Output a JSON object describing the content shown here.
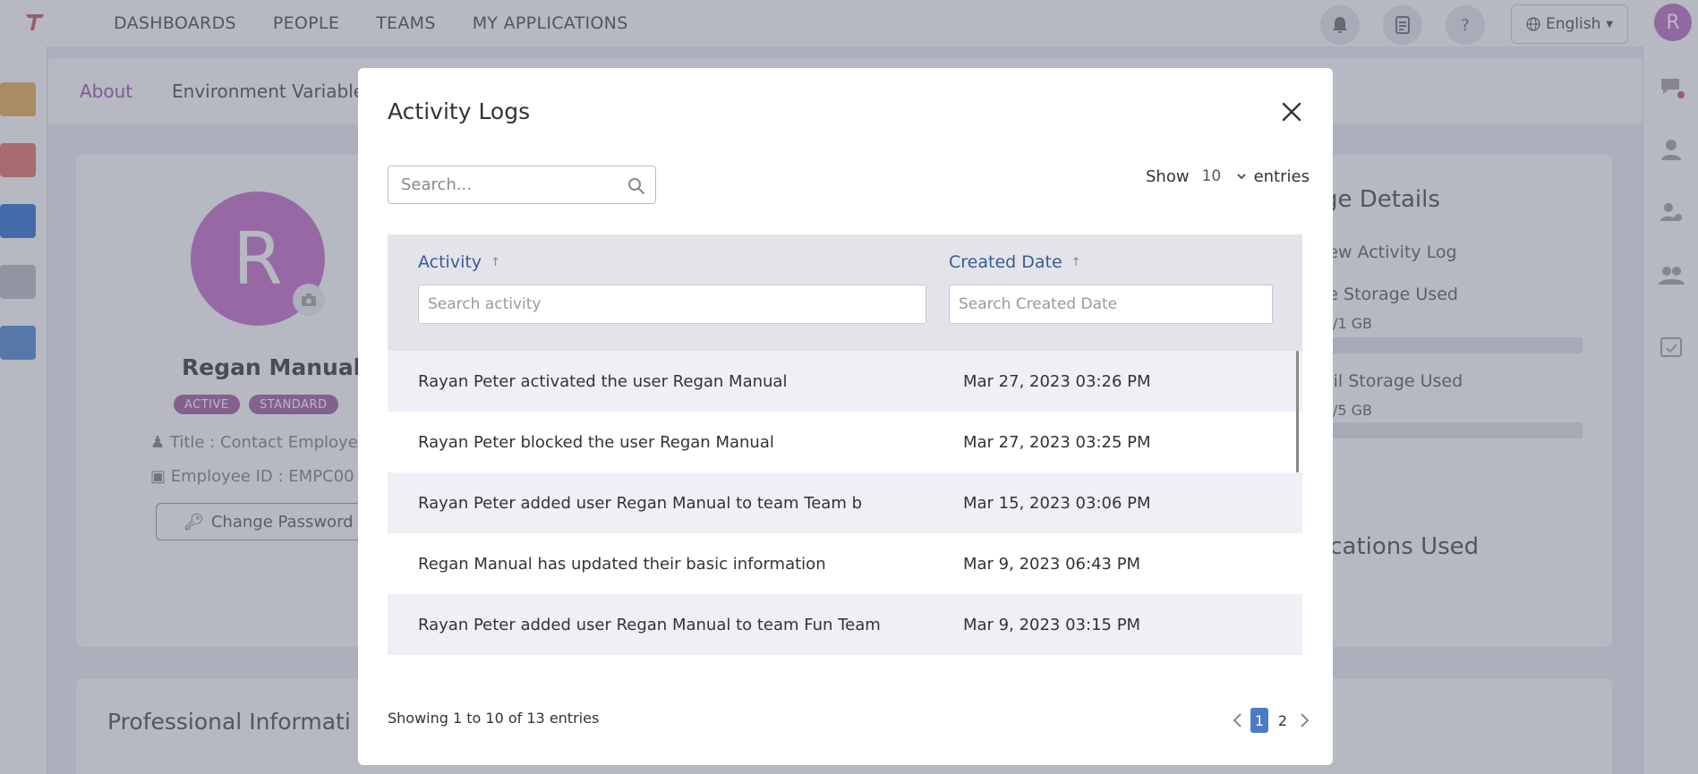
{
  "nav": {
    "items": [
      "DASHBOARDS",
      "PEOPLE",
      "TEAMS",
      "MY APPLICATIONS"
    ],
    "language": "English",
    "user_initial": "R"
  },
  "subtabs": [
    "About",
    "Environment Variable"
  ],
  "profile": {
    "initial": "R",
    "name": "Regan Manual",
    "badges": [
      "ACTIVE",
      "STANDARD"
    ],
    "title": "Title : Contact Employe",
    "employee_id": "Employee ID : EMPC00",
    "change_password": "Change Password"
  },
  "right_panel": {
    "heading": "ge Details",
    "view_log": "iew Activity Log",
    "file_storage": "le Storage Used",
    "file_storage_value": "B/1 GB",
    "mail_storage": "ail Storage Used",
    "mail_storage_value": "B/5 GB",
    "apps_heading": "ications Used"
  },
  "professional": {
    "heading": "Professional Informati"
  },
  "modal": {
    "title": "Activity Logs",
    "search_placeholder": "Search...",
    "show_label": "Show",
    "entries_count": "10",
    "entries_label": "entries",
    "columns": [
      {
        "label": "Activity",
        "filter_placeholder": "Search activity"
      },
      {
        "label": "Created Date",
        "filter_placeholder": "Search Created Date"
      }
    ],
    "rows": [
      {
        "activity": "Rayan Peter activated the user Regan Manual",
        "date": "Mar 27, 2023 03:26 PM"
      },
      {
        "activity": "Rayan Peter blocked the user Regan Manual",
        "date": "Mar 27, 2023 03:25 PM"
      },
      {
        "activity": "Rayan Peter added user Regan Manual to team Team b",
        "date": "Mar 15, 2023 03:06 PM"
      },
      {
        "activity": "Regan Manual has updated their basic information",
        "date": "Mar 9, 2023 06:43 PM"
      },
      {
        "activity": "Rayan Peter added user Regan Manual to team Fun Team",
        "date": "Mar 9, 2023 03:15 PM"
      }
    ],
    "footer": "Showing 1 to 10 of 13 entries",
    "pages": [
      "1",
      "2"
    ],
    "current_page": "1"
  },
  "colors": {
    "accent": "#a45fb5",
    "avatar": "#c878cc",
    "link_blue": "#3a5a95",
    "pager_active": "#4a7cc4",
    "overlay": "rgba(80,85,110,0.42)"
  }
}
